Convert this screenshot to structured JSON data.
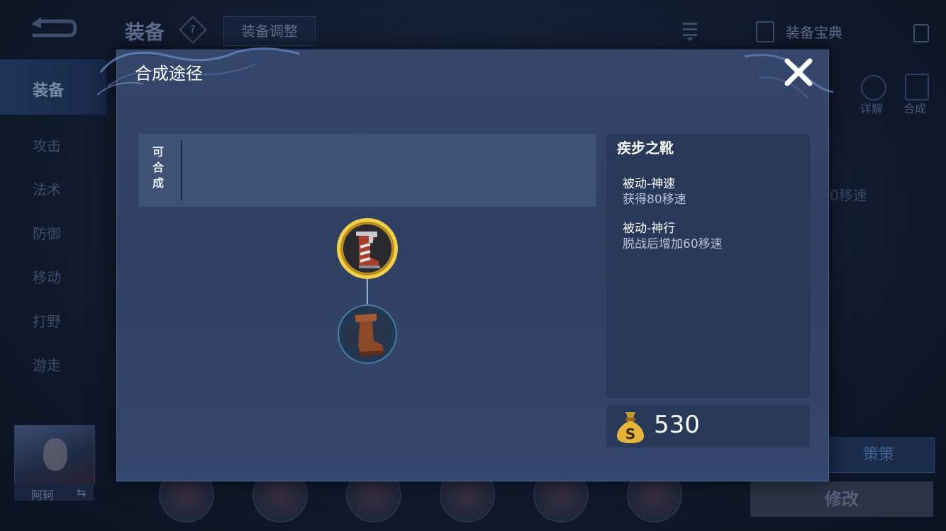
{
  "background": {
    "top_title": "装备",
    "help_icon": "?",
    "adjust_button": "装备调整",
    "codex_label": "装备宝典",
    "sidebar": [
      {
        "label": "装备",
        "active": true
      },
      {
        "label": "攻击",
        "active": false
      },
      {
        "label": "法术",
        "active": false
      },
      {
        "label": "防御",
        "active": false
      },
      {
        "label": "移动",
        "active": false
      },
      {
        "label": "打野",
        "active": false
      },
      {
        "label": "游走",
        "active": false
      }
    ],
    "hero_name": "阿轲",
    "swap_icon": "⇆",
    "right_detail_label": "详解",
    "right_compose_label": "合成",
    "partial_text": "0移速",
    "plan_button": "策策",
    "modify_button": "修改"
  },
  "dialog": {
    "title": "合成途径",
    "close_icon": "close-icon",
    "can_compose_label": "可合成",
    "tree": {
      "main_item": "boots-of-haste-icon",
      "sub_item": "leather-boots-icon"
    },
    "item": {
      "name": "疾步之靴",
      "passives": [
        {
          "name": "被动-神速",
          "desc": "获得80移速"
        },
        {
          "name": "被动-神行",
          "desc": "脱战后增加60移速"
        }
      ],
      "price": "530"
    }
  },
  "colors": {
    "dialog_bg": "#2f4063",
    "accent_gold": "#e3b53a",
    "panel_bg": "#283959"
  }
}
